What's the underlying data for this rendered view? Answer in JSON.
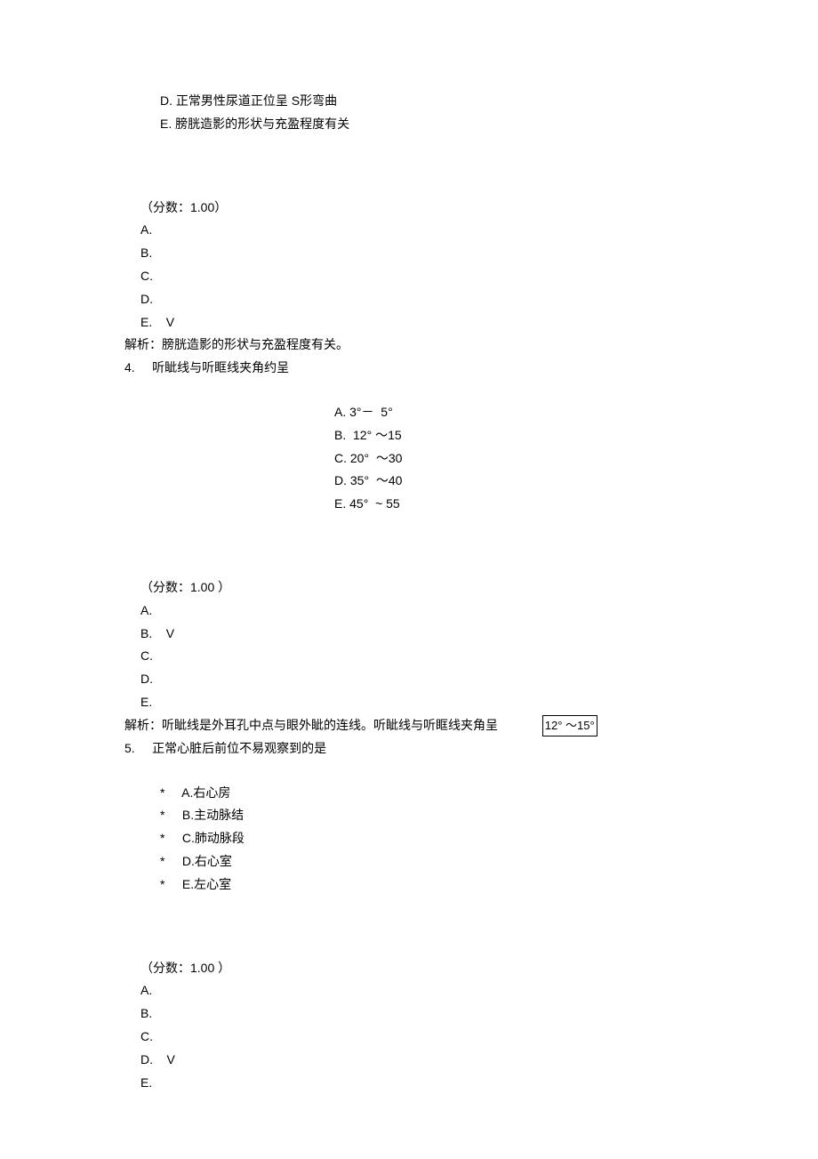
{
  "q3": {
    "options": {
      "d": "D.  正常男性尿道正位呈 S形弯曲",
      "e": "E.  膀胱造影的形状与充盈程度有关"
    },
    "score_label": "（分数：1.00）",
    "answers": {
      "a": "A.",
      "b": "B.",
      "c": "C.",
      "d": "D.",
      "e": "E.    V"
    },
    "explain": "解析：膀胱造影的形状与充盈程度有关。"
  },
  "q4": {
    "header": "4.     听眦线与听眶线夹角约呈",
    "options": {
      "a": "A. 3°－  5°",
      "b": "B.  12° ～15",
      "c": "C. 20°  ～30",
      "d": "D. 35°  ～40",
      "e": "E. 45°  ~ 55"
    },
    "score_label": "（分数：1.00 ）",
    "answers": {
      "a": "A.",
      "b": "B.    V",
      "c": "C.",
      "d": "D.",
      "e": "E."
    },
    "explain_prefix": "解析：听眦线是外耳孔中点与眼外眦的连线。听眦线与听眶线夹角呈",
    "explain_boxed": "12° ～15°"
  },
  "q5": {
    "header": "5.     正常心脏后前位不易观察到的是",
    "options": {
      "a": "*     A.右心房",
      "b": "*     B.主动脉结",
      "c": "*     C.肺动脉段",
      "d": "*     D.右心室",
      "e": "*     E.左心室"
    },
    "score_label": "（分数：1.00 ）",
    "answers": {
      "a": "A.",
      "b": "B.",
      "c": "C.",
      "d": "D.    V",
      "e": "E."
    }
  }
}
